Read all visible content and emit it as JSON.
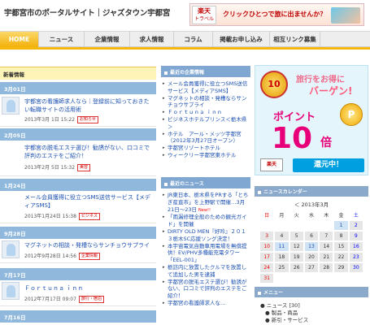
{
  "header": {
    "site_title": "宇都宮市のポータルサイト｜ジャズタウン宇都宮",
    "rakuten_logo_line1": "楽天",
    "rakuten_logo_line2": "トラベル",
    "banner_text": "クリックひとつで旅に出ませんか？"
  },
  "nav": [
    "HOME",
    "ニュース",
    "企業情報",
    "求人情報",
    "コラム",
    "掲載お申し込み",
    "相互リンク募集"
  ],
  "left": {
    "section_title": "新着情報",
    "posts": [
      {
        "date": "3月01日",
        "title": "宇都宮の看護師求人なら｜登録前に知っておきたい転職サイトの活用術",
        "meta": "2013年3月 1日 15:22",
        "badge": "お知らせ",
        "thumb": "person"
      },
      {
        "date": "2月05日",
        "title": "宇都宮の脱毛エステ選び！勧誘がない、口コミで評判のエステをご紹介！",
        "meta": "2013年2月 5日 15:32",
        "badge": "美容",
        "thumb": "none"
      },
      {
        "date": "1月24日",
        "title": "メール会員獲得に役立つSMS送信サービス【メディアSMS】",
        "meta": "2013年1月24日 15:38",
        "badge": "ビジネス",
        "thumb": "none"
      },
      {
        "date": "9月28日",
        "title": "マグネットの相談・発槽ならサンチョウサプライ",
        "meta": "2012年9月28日 14:56",
        "badge": "企業情報",
        "thumb": "doc"
      },
      {
        "date": "7月17日",
        "title": "Ｆｏｒｔｕｎａ ｉｎｎ",
        "meta": "2012年7月17日 09:07",
        "badge": "旅行・宿泊",
        "thumb": "doc"
      },
      {
        "date": "7月16日"
      }
    ]
  },
  "middle": {
    "box1_title": "最近の企業情報",
    "box1_items": [
      "メール会員獲得に役立つSMS送信サービス【メディアSMS】",
      "マグネットの相談・発槽ならサンチョウサプライ",
      "Ｆｏｒｔｕｎａ ｉｎｎ",
      "ビジネスホテルプリンス＜栃木県＞",
      "ホテル　アール・メッツ宇都宮（2012年3月27日オープン）",
      "宇都宮リゾートホテル",
      "ウィークリー宇都宮東ホテル"
    ],
    "box2_title": "最近のニュース",
    "box2_items": [
      {
        "text": "JR東日本、栃木県をPRする「とちぎ産直市」を上野駅で開催…3月21日～23日",
        "new": true
      },
      {
        "text": "「雨漏修理全般のための観光ガイド」を開催",
        "new": false
      },
      {
        "text": "DIRTY OLD MEN『好吟』２０１３栃木SC応援ソング決定！",
        "new": false
      },
      {
        "text": "本宇宙電気自動車用電場を無償提供！EV/PHV多種能充電タワー「EEL-001」",
        "new": false
      },
      {
        "text": "栃訪内に放置したクルマを放置して追加した男を逮捕",
        "new": false
      },
      {
        "text": "宇都宮の脱毛エステ選び！勧誘がない、口コミで評判のエステをご紹介！",
        "new": false
      },
      {
        "text": "宇都宮の看護師求人な…",
        "new": false
      }
    ]
  },
  "right": {
    "ad": {
      "medal_text": "10",
      "line1": "旅行をお得に",
      "line2": "バーゲン!",
      "point_text": "ポイント",
      "coin_text": "P",
      "big_number": "10",
      "multiplier": "倍",
      "logo_text": "楽天",
      "bottom_text": "還元中！"
    },
    "calendar_title": "ニュースカレンダー",
    "calendar_nav": "＜ 2013年3月",
    "weekdays": [
      "日",
      "月",
      "火",
      "水",
      "木",
      "金",
      "土"
    ],
    "calendar_rows": [
      [
        "",
        "",
        "",
        "",
        "",
        "1",
        "2"
      ],
      [
        "3",
        "4",
        "5",
        "6",
        "7",
        "8",
        "9"
      ],
      [
        "10",
        "11",
        "12",
        "13",
        "14",
        "15",
        "16"
      ],
      [
        "17",
        "18",
        "19",
        "20",
        "21",
        "22",
        "23"
      ],
      [
        "24",
        "25",
        "26",
        "27",
        "28",
        "29",
        "30"
      ],
      [
        "31",
        "",
        "",
        "",
        "",
        "",
        ""
      ]
    ],
    "menu_title": "メニュー",
    "menu_items": [
      "ニュース [30]",
      "製品・商品",
      "新引・サービス"
    ]
  }
}
